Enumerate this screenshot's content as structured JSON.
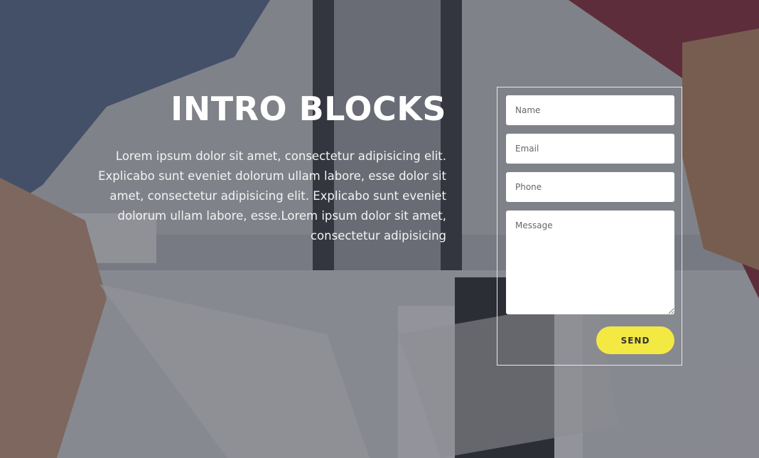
{
  "hero": {
    "title": "INTRO BLOCKS",
    "text": "Lorem ipsum dolor sit amet, consectetur adipisicing elit. Explicabo sunt eveniet dolorum ullam labore, esse dolor sit amet, consectetur adipisicing elit. Explicabo sunt eveniet dolorum ullam labore, esse.Lorem ipsum dolor sit amet, consectetur adipisicing"
  },
  "form": {
    "name_placeholder": "Name",
    "email_placeholder": "Email",
    "phone_placeholder": "Phone",
    "message_placeholder": "Message",
    "send_label": "SEND"
  },
  "colors": {
    "send_button": "#f4e842",
    "overlay": "#282a36"
  }
}
